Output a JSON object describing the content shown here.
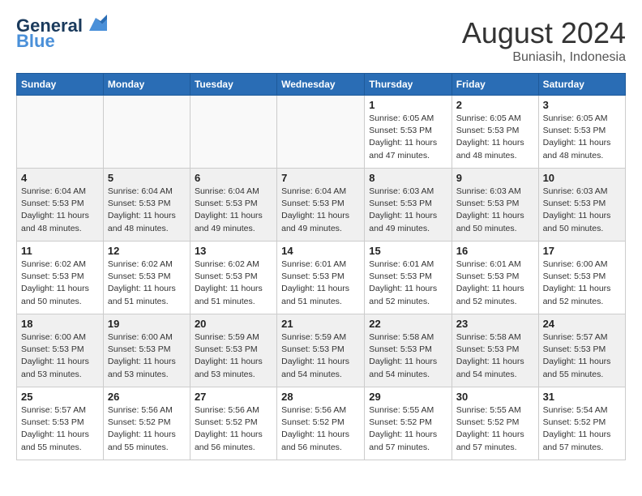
{
  "header": {
    "logo_line1": "General",
    "logo_line2": "Blue",
    "month_year": "August 2024",
    "location": "Buniasih, Indonesia"
  },
  "weekdays": [
    "Sunday",
    "Monday",
    "Tuesday",
    "Wednesday",
    "Thursday",
    "Friday",
    "Saturday"
  ],
  "weeks": [
    [
      {
        "day": "",
        "info": ""
      },
      {
        "day": "",
        "info": ""
      },
      {
        "day": "",
        "info": ""
      },
      {
        "day": "",
        "info": ""
      },
      {
        "day": "1",
        "info": "Sunrise: 6:05 AM\nSunset: 5:53 PM\nDaylight: 11 hours\nand 47 minutes."
      },
      {
        "day": "2",
        "info": "Sunrise: 6:05 AM\nSunset: 5:53 PM\nDaylight: 11 hours\nand 48 minutes."
      },
      {
        "day": "3",
        "info": "Sunrise: 6:05 AM\nSunset: 5:53 PM\nDaylight: 11 hours\nand 48 minutes."
      }
    ],
    [
      {
        "day": "4",
        "info": "Sunrise: 6:04 AM\nSunset: 5:53 PM\nDaylight: 11 hours\nand 48 minutes."
      },
      {
        "day": "5",
        "info": "Sunrise: 6:04 AM\nSunset: 5:53 PM\nDaylight: 11 hours\nand 48 minutes."
      },
      {
        "day": "6",
        "info": "Sunrise: 6:04 AM\nSunset: 5:53 PM\nDaylight: 11 hours\nand 49 minutes."
      },
      {
        "day": "7",
        "info": "Sunrise: 6:04 AM\nSunset: 5:53 PM\nDaylight: 11 hours\nand 49 minutes."
      },
      {
        "day": "8",
        "info": "Sunrise: 6:03 AM\nSunset: 5:53 PM\nDaylight: 11 hours\nand 49 minutes."
      },
      {
        "day": "9",
        "info": "Sunrise: 6:03 AM\nSunset: 5:53 PM\nDaylight: 11 hours\nand 50 minutes."
      },
      {
        "day": "10",
        "info": "Sunrise: 6:03 AM\nSunset: 5:53 PM\nDaylight: 11 hours\nand 50 minutes."
      }
    ],
    [
      {
        "day": "11",
        "info": "Sunrise: 6:02 AM\nSunset: 5:53 PM\nDaylight: 11 hours\nand 50 minutes."
      },
      {
        "day": "12",
        "info": "Sunrise: 6:02 AM\nSunset: 5:53 PM\nDaylight: 11 hours\nand 51 minutes."
      },
      {
        "day": "13",
        "info": "Sunrise: 6:02 AM\nSunset: 5:53 PM\nDaylight: 11 hours\nand 51 minutes."
      },
      {
        "day": "14",
        "info": "Sunrise: 6:01 AM\nSunset: 5:53 PM\nDaylight: 11 hours\nand 51 minutes."
      },
      {
        "day": "15",
        "info": "Sunrise: 6:01 AM\nSunset: 5:53 PM\nDaylight: 11 hours\nand 52 minutes."
      },
      {
        "day": "16",
        "info": "Sunrise: 6:01 AM\nSunset: 5:53 PM\nDaylight: 11 hours\nand 52 minutes."
      },
      {
        "day": "17",
        "info": "Sunrise: 6:00 AM\nSunset: 5:53 PM\nDaylight: 11 hours\nand 52 minutes."
      }
    ],
    [
      {
        "day": "18",
        "info": "Sunrise: 6:00 AM\nSunset: 5:53 PM\nDaylight: 11 hours\nand 53 minutes."
      },
      {
        "day": "19",
        "info": "Sunrise: 6:00 AM\nSunset: 5:53 PM\nDaylight: 11 hours\nand 53 minutes."
      },
      {
        "day": "20",
        "info": "Sunrise: 5:59 AM\nSunset: 5:53 PM\nDaylight: 11 hours\nand 53 minutes."
      },
      {
        "day": "21",
        "info": "Sunrise: 5:59 AM\nSunset: 5:53 PM\nDaylight: 11 hours\nand 54 minutes."
      },
      {
        "day": "22",
        "info": "Sunrise: 5:58 AM\nSunset: 5:53 PM\nDaylight: 11 hours\nand 54 minutes."
      },
      {
        "day": "23",
        "info": "Sunrise: 5:58 AM\nSunset: 5:53 PM\nDaylight: 11 hours\nand 54 minutes."
      },
      {
        "day": "24",
        "info": "Sunrise: 5:57 AM\nSunset: 5:53 PM\nDaylight: 11 hours\nand 55 minutes."
      }
    ],
    [
      {
        "day": "25",
        "info": "Sunrise: 5:57 AM\nSunset: 5:53 PM\nDaylight: 11 hours\nand 55 minutes."
      },
      {
        "day": "26",
        "info": "Sunrise: 5:56 AM\nSunset: 5:52 PM\nDaylight: 11 hours\nand 55 minutes."
      },
      {
        "day": "27",
        "info": "Sunrise: 5:56 AM\nSunset: 5:52 PM\nDaylight: 11 hours\nand 56 minutes."
      },
      {
        "day": "28",
        "info": "Sunrise: 5:56 AM\nSunset: 5:52 PM\nDaylight: 11 hours\nand 56 minutes."
      },
      {
        "day": "29",
        "info": "Sunrise: 5:55 AM\nSunset: 5:52 PM\nDaylight: 11 hours\nand 57 minutes."
      },
      {
        "day": "30",
        "info": "Sunrise: 5:55 AM\nSunset: 5:52 PM\nDaylight: 11 hours\nand 57 minutes."
      },
      {
        "day": "31",
        "info": "Sunrise: 5:54 AM\nSunset: 5:52 PM\nDaylight: 11 hours\nand 57 minutes."
      }
    ]
  ]
}
